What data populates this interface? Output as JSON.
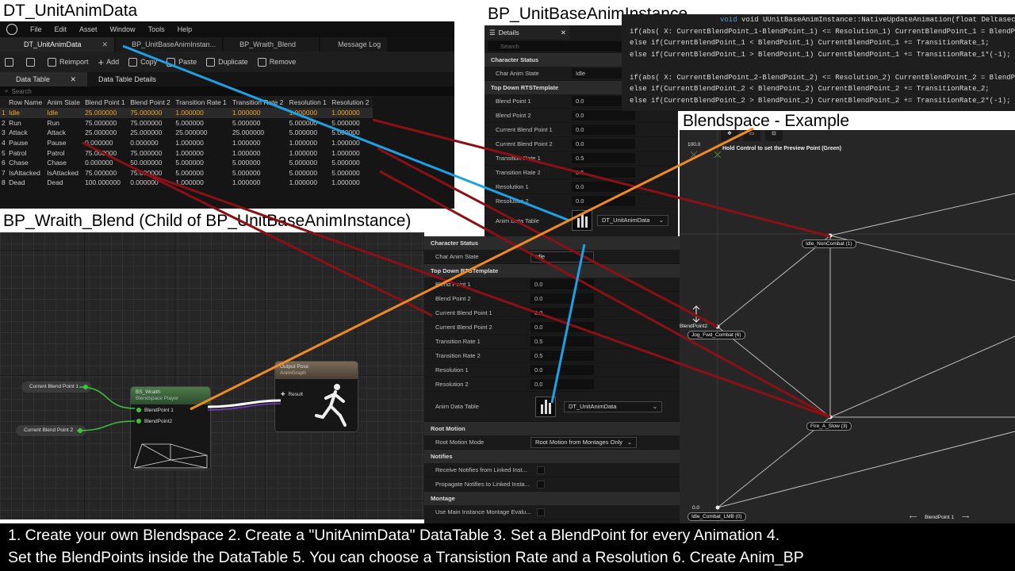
{
  "labels": {
    "dt_title": "DT_UnitAnimData",
    "anim_title": "BP_UnitBaseAnimInstance",
    "blendspace_title": "Blendspace - Example",
    "wraith_title": "BP_Wraith_Blend  (Child of BP_UnitBaseAnimInstance)"
  },
  "editor": {
    "menu": [
      "File",
      "Edit",
      "Asset",
      "Window",
      "Tools",
      "Help"
    ],
    "tabs": [
      "DT_UnitAnimData",
      "BP_UnitBaseAnimInstan...",
      "BP_Wraith_Blend",
      "Message Log"
    ],
    "toolbar": {
      "reimport": "Reimport",
      "add": "Add",
      "copy": "Copy",
      "paste": "Paste",
      "duplicate": "Duplicate",
      "remove": "Remove"
    },
    "subtabs": {
      "data_table": "Data Table",
      "details": "Data Table Details"
    },
    "search_placeholder": "Search"
  },
  "data_table": {
    "columns": [
      "",
      "Row Name",
      "Anim State",
      "Blend Point 1",
      "Blend Point 2",
      "Transition Rate 1",
      "Transition Rate 2",
      "Resolution 1",
      "Resolution 2"
    ],
    "rows": [
      [
        "1",
        "Idle",
        "Idle",
        "25.000000",
        "75.000000",
        "1.000000",
        "1.000000",
        "1.000000",
        "1.000000"
      ],
      [
        "2",
        "Run",
        "Run",
        "75.000000",
        "75.000000",
        "5.000000",
        "5.000000",
        "5.000000",
        "5.000000"
      ],
      [
        "3",
        "Attack",
        "Attack",
        "25.000000",
        "25.000000",
        "25.000000",
        "25.000000",
        "5.000000",
        "5.000000"
      ],
      [
        "4",
        "Pause",
        "Pause",
        "0.000000",
        "0.000000",
        "1.000000",
        "1.000000",
        "1.000000",
        "1.000000"
      ],
      [
        "5",
        "Patrol",
        "Patrol",
        "75.000000",
        "75.000000",
        "1.000000",
        "1.000000",
        "1.000000",
        "1.000000"
      ],
      [
        "6",
        "Chase",
        "Chase",
        "0.000000",
        "50.000000",
        "5.000000",
        "5.000000",
        "5.000000",
        "5.000000"
      ],
      [
        "7",
        "IsAttacked",
        "IsAttacked",
        "75.000000",
        "75.000000",
        "5.000000",
        "5.000000",
        "5.000000",
        "5.000000"
      ],
      [
        "8",
        "Dead",
        "Dead",
        "100.000000",
        "0.000000",
        "1.000000",
        "1.000000",
        "1.000000",
        "1.000000"
      ]
    ]
  },
  "details_top": {
    "tab": "Details",
    "search": "Search",
    "section_character": "Character Status",
    "char_anim_state_label": "Char Anim State",
    "char_anim_state_value": "Idle",
    "section_topdown": "Top Down RTSTemplate",
    "props": [
      {
        "label": "Blend Point 1",
        "value": "0.0"
      },
      {
        "label": "Blend Point 2",
        "value": "0.0"
      },
      {
        "label": "Current Blend Point 1",
        "value": "0.0"
      },
      {
        "label": "Current Blend Point 2",
        "value": "0.0"
      },
      {
        "label": "Transition Rate 1",
        "value": "0.5"
      },
      {
        "label": "Transition Rate 2",
        "value": "0.5"
      },
      {
        "label": "Resolution 1",
        "value": "0.0"
      },
      {
        "label": "Resolution 2",
        "value": "0.0"
      }
    ],
    "anim_data_table_label": "Anim Data Table",
    "anim_data_table_value": "DT_UnitAnimData"
  },
  "details_bottom": {
    "section_character": "Character Status",
    "char_anim_state_label": "Char Anim State",
    "char_anim_state_value": "Idle",
    "section_topdown": "Top Down RTSTemplate",
    "props": [
      {
        "label": "Blend Point 1",
        "value": "0.0"
      },
      {
        "label": "Blend Point 2",
        "value": "0.0"
      },
      {
        "label": "Current Blend Point 1",
        "value": "0.0"
      },
      {
        "label": "Current Blend Point 2",
        "value": "0.0"
      },
      {
        "label": "Transition Rate 1",
        "value": "0.5"
      },
      {
        "label": "Transition Rate 2",
        "value": "0.5"
      },
      {
        "label": "Resolution 1",
        "value": "0.0"
      },
      {
        "label": "Resolution 2",
        "value": "0.0"
      }
    ],
    "anim_data_table_label": "Anim Data Table",
    "anim_data_table_value": "DT_UnitAnimData",
    "section_root_motion": "Root Motion",
    "root_motion_mode_label": "Root Motion Mode",
    "root_motion_mode_value": "Root Motion from Montages Only",
    "section_notifies": "Notifies",
    "receive_notifies": "Receive Notifies from Linked Inst...",
    "propagate_notifies": "Propagate Notifies to Linked Insta...",
    "section_montage": "Montage",
    "use_main_montage": "Use Main Instance Montage Evalu..."
  },
  "code": {
    "header": "void UUnitBaseAnimInstance::NativeUpdateAnimation(float Deltaseconds)",
    "lines": [
      "if(abs( X: CurrentBlendPoint_1-BlendPoint_1) <= Resolution_1) CurrentBlendPoint_1 = BlendPoi",
      "else if(CurrentBlendPoint_1 < BlendPoint_1) CurrentBlendPoint_1 += TransitionRate_1;",
      "else if(CurrentBlendPoint_1 > BlendPoint_1) CurrentBlendPoint_1 += TransitionRate_1*(-1);",
      "",
      "if(abs( X: CurrentBlendPoint_2-BlendPoint_2) <= Resolution_2) CurrentBlendPoint_2 = BlendPoi",
      "else if(CurrentBlendPoint_2 < BlendPoint_2) CurrentBlendPoint_2 += TransitionRate_2;",
      "else if(CurrentBlendPoint_2 > BlendPoint_2) CurrentBlendPoint_2 += TransitionRate_2*(-1);"
    ]
  },
  "graph": {
    "var1": "Current Blend Point 1",
    "var2": "Current Blend Point 2",
    "node_title": "BS_Wraith",
    "node_subtitle": "Blendspace Player",
    "pin1": "BlendPoint 1",
    "pin2": "BlendPoint2",
    "output_title": "Output Pose",
    "output_subtitle": "AnimGraph",
    "result": "Result"
  },
  "blendspace": {
    "hint": "Hold Control to set the Preview Point (Green)",
    "y_max": "100.0",
    "y_min": "0.0",
    "axis_y": "BlendPoint2",
    "axis_x": "BlendPoint 1",
    "samples": [
      "Idle_NonCombat (1)",
      "Jog_Fwd_Combat (6)",
      "Fire_A_Slow (3)",
      "Idle_Combat_LMB (0)"
    ]
  },
  "caption": {
    "line1": "1. Create your own Blendspace 2. Create a \"UnitAnimData\" DataTable 3. Set a BlendPoint for every Animation 4.",
    "line2": "Set the BlendPoints inside the DataTable 5. You can choose a Transistion Rate and a Resolution 6. Create Anim_BP"
  }
}
